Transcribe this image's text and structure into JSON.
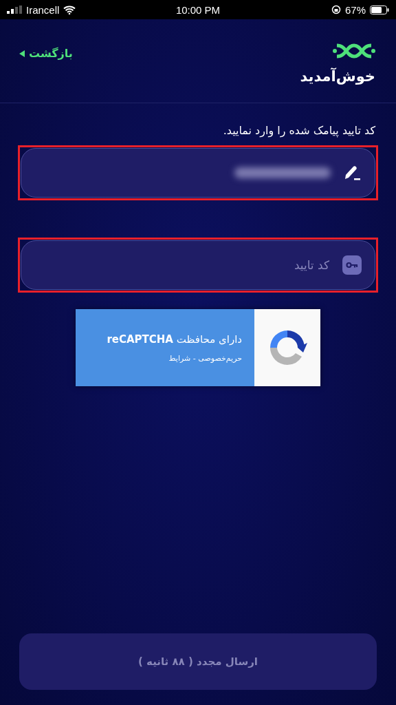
{
  "status_bar": {
    "carrier": "Irancell",
    "time": "10:00 PM",
    "battery": "67%"
  },
  "header": {
    "back": "بازگشت",
    "title": "خوش‌آمدید"
  },
  "instruction": "کد تایید پیامک شده را وارد نمایید.",
  "fields": [
    {
      "kind": "blurred",
      "highlighted": true
    },
    {
      "kind": "input",
      "placeholder": "کد تایید",
      "highlighted": true
    }
  ],
  "captcha": {
    "title": "دارای محافظت **reCAPTCHA**",
    "links": "حریم‌خصوصی - شرایط"
  },
  "resend_button": {
    "label": "ارسال مجدد ( ۸۸ ثانیه )",
    "disabled": true
  }
}
